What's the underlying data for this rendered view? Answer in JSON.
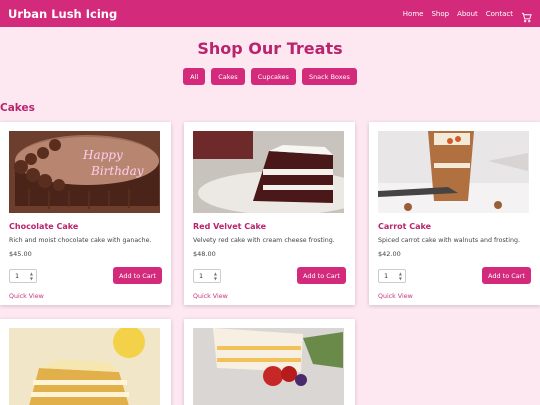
{
  "brand": "Urban Lush Icing",
  "nav": [
    "Home",
    "Shop",
    "About",
    "Contact"
  ],
  "page_title": "Shop Our Treats",
  "filters": [
    "All",
    "Cakes",
    "Cupcakes",
    "Snack Boxes"
  ],
  "section_title": "Cakes",
  "products": [
    {
      "name": "Chocolate Cake",
      "desc": "Rich and moist chocolate cake with ganache.",
      "price": "$45.00",
      "qty": "1",
      "add_label": "Add to Cart",
      "quick_view": "Quick View",
      "image_text": "Happy Birthday"
    },
    {
      "name": "Red Velvet Cake",
      "desc": "Velvety red cake with cream cheese frosting.",
      "price": "$48.00",
      "qty": "1",
      "add_label": "Add to Cart",
      "quick_view": "Quick View"
    },
    {
      "name": "Carrot Cake",
      "desc": "Spiced carrot cake with walnuts and frosting.",
      "price": "$42.00",
      "qty": "1",
      "add_label": "Add to Cart",
      "quick_view": "Quick View"
    }
  ],
  "colors": {
    "accent": "#d42a7c",
    "heading": "#b8246d",
    "background": "#fde7f1"
  }
}
